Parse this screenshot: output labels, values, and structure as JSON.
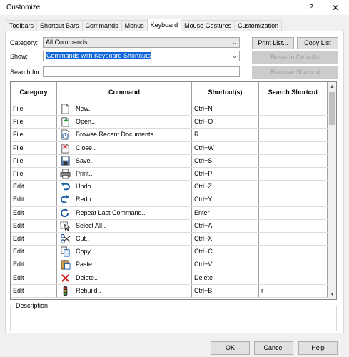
{
  "window": {
    "title": "Customize",
    "help_glyph": "?",
    "close_glyph": "✕"
  },
  "tabs": [
    {
      "label": "Toolbars"
    },
    {
      "label": "Shortcut Bars"
    },
    {
      "label": "Commands"
    },
    {
      "label": "Menus"
    },
    {
      "label": "Keyboard"
    },
    {
      "label": "Mouse Gestures"
    },
    {
      "label": "Customization"
    }
  ],
  "active_tab": "Keyboard",
  "form": {
    "category_label": "Category:",
    "category_value": "All Commands",
    "show_label": "Show:",
    "show_value": "Commands with Keyboard Shortcuts",
    "search_label": "Search for:",
    "search_value": ""
  },
  "buttons": {
    "print_list": "Print List...",
    "copy_list": "Copy List",
    "reset_defaults": "Reset to Defaults",
    "remove_shortcut": "Remove Shortcut",
    "ok": "OK",
    "cancel": "Cancel",
    "help": "Help"
  },
  "grid": {
    "columns": [
      "Category",
      "Command",
      "Shortcut(s)",
      "Search Shortcut"
    ],
    "rows": [
      {
        "category": "File",
        "icon": "new-document-icon",
        "command": "New..",
        "shortcut": "Ctrl+N",
        "search": ""
      },
      {
        "category": "File",
        "icon": "open-folder-icon",
        "command": "Open..",
        "shortcut": "Ctrl+O",
        "search": ""
      },
      {
        "category": "File",
        "icon": "recent-documents-icon",
        "command": "Browse Recent Documents..",
        "shortcut": "R",
        "search": ""
      },
      {
        "category": "File",
        "icon": "close-document-icon",
        "command": "Close..",
        "shortcut": "Ctrl+W",
        "search": ""
      },
      {
        "category": "File",
        "icon": "save-disk-icon",
        "command": "Save..",
        "shortcut": "Ctrl+S",
        "search": ""
      },
      {
        "category": "File",
        "icon": "printer-icon",
        "command": "Print..",
        "shortcut": "Ctrl+P",
        "search": ""
      },
      {
        "category": "Edit",
        "icon": "undo-icon",
        "command": "Undo..",
        "shortcut": "Ctrl+Z",
        "search": ""
      },
      {
        "category": "Edit",
        "icon": "redo-icon",
        "command": "Redo..",
        "shortcut": "Ctrl+Y",
        "search": ""
      },
      {
        "category": "Edit",
        "icon": "repeat-command-icon",
        "command": "Repeat Last Command..",
        "shortcut": "Enter",
        "search": ""
      },
      {
        "category": "Edit",
        "icon": "select-all-icon",
        "command": "Select All..",
        "shortcut": "Ctrl+A",
        "search": ""
      },
      {
        "category": "Edit",
        "icon": "scissors-icon",
        "command": "Cut..",
        "shortcut": "Ctrl+X",
        "search": ""
      },
      {
        "category": "Edit",
        "icon": "copy-icon",
        "command": "Copy..",
        "shortcut": "Ctrl+C",
        "search": ""
      },
      {
        "category": "Edit",
        "icon": "paste-icon",
        "command": "Paste..",
        "shortcut": "Ctrl+V",
        "search": ""
      },
      {
        "category": "Edit",
        "icon": "delete-x-icon",
        "command": "Delete..",
        "shortcut": "Delete",
        "search": ""
      },
      {
        "category": "Edit",
        "icon": "rebuild-traffic-light-icon",
        "command": "Rebuild..",
        "shortcut": "Ctrl+B",
        "search": "r"
      }
    ]
  },
  "description_label": "Description"
}
